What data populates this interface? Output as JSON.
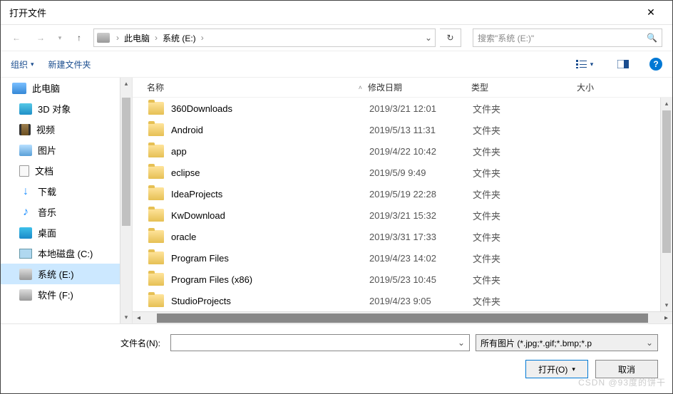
{
  "title": "打开文件",
  "breadcrumb": {
    "root": "此电脑",
    "folder": "系统 (E:)"
  },
  "search_placeholder": "搜索\"系统 (E:)\"",
  "toolbar": {
    "organize": "组织",
    "new_folder": "新建文件夹"
  },
  "sidebar": {
    "root": "此电脑",
    "items": [
      {
        "label": "3D 对象",
        "icon": "cube"
      },
      {
        "label": "视频",
        "icon": "film"
      },
      {
        "label": "图片",
        "icon": "pic"
      },
      {
        "label": "文档",
        "icon": "doc"
      },
      {
        "label": "下载",
        "icon": "dl"
      },
      {
        "label": "音乐",
        "icon": "music"
      },
      {
        "label": "桌面",
        "icon": "desk"
      },
      {
        "label": "本地磁盘 (C:)",
        "icon": "diskc"
      },
      {
        "label": "系统 (E:)",
        "icon": "disk",
        "selected": true
      },
      {
        "label": "软件 (F:)",
        "icon": "disk"
      }
    ]
  },
  "columns": {
    "name": "名称",
    "date": "修改日期",
    "type": "类型",
    "size": "大小"
  },
  "folder_type": "文件夹",
  "files": [
    {
      "name": "360Downloads",
      "date": "2019/3/21 12:01"
    },
    {
      "name": "Android",
      "date": "2019/5/13 11:31"
    },
    {
      "name": "app",
      "date": "2019/4/22 10:42"
    },
    {
      "name": "eclipse",
      "date": "2019/5/9 9:49"
    },
    {
      "name": "IdeaProjects",
      "date": "2019/5/19 22:28"
    },
    {
      "name": "KwDownload",
      "date": "2019/3/21 15:32"
    },
    {
      "name": "oracle",
      "date": "2019/3/31 17:33"
    },
    {
      "name": "Program Files",
      "date": "2019/4/23 14:02"
    },
    {
      "name": "Program Files (x86)",
      "date": "2019/5/23 10:45"
    },
    {
      "name": "StudioProjects",
      "date": "2019/4/23 9:05"
    }
  ],
  "footer": {
    "filename_label": "文件名(N):",
    "filter": "所有图片 (*.jpg;*.gif;*.bmp;*.p",
    "open": "打开(O)",
    "cancel": "取消"
  },
  "watermark": "CSDN @93度的饼干"
}
